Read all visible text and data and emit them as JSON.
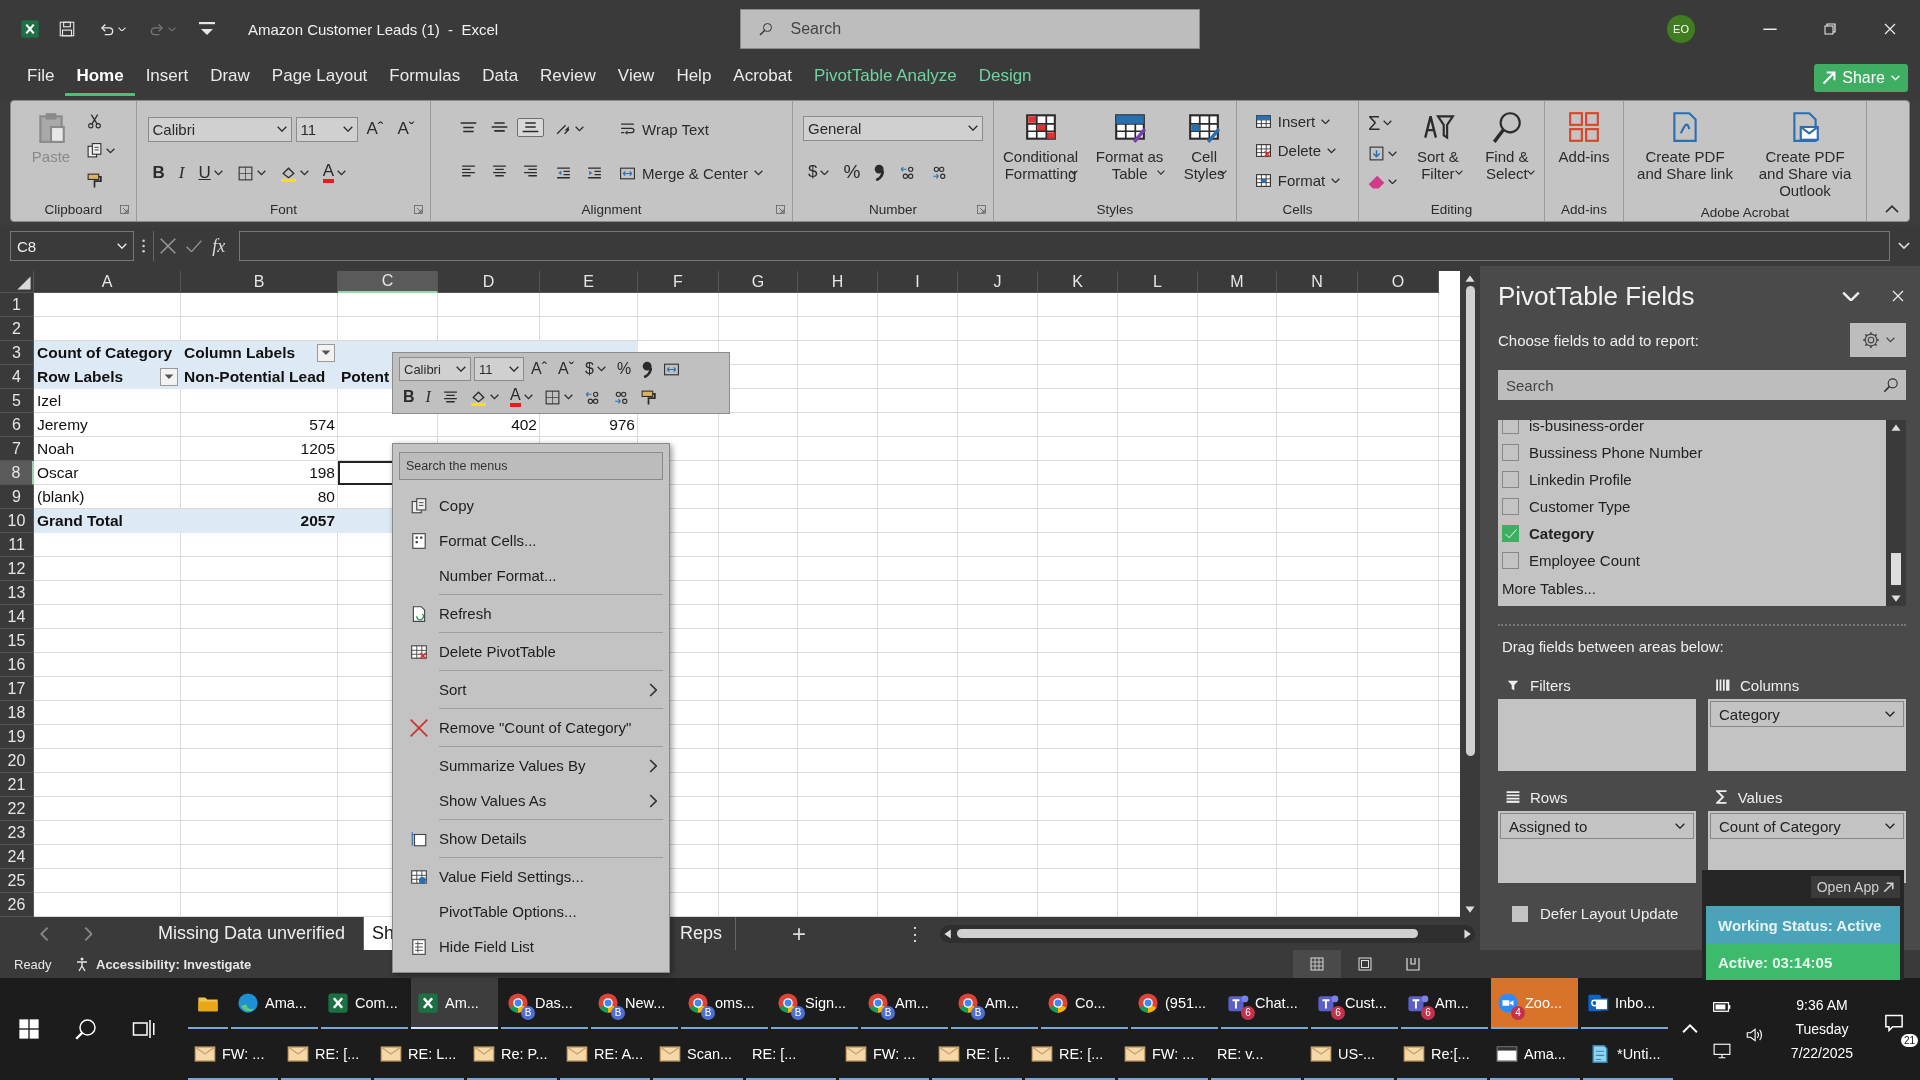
{
  "title_bar": {
    "quick_access": [
      {
        "kind": "save",
        "disabled": false
      },
      {
        "kind": "undo",
        "disabled": false
      },
      {
        "kind": "redo",
        "disabled": true
      },
      {
        "kind": "customize",
        "disabled": false
      }
    ],
    "document_title": "Amazon Customer Leads (1)  -  Excel",
    "search": {
      "placeholder": "Search"
    },
    "account": {
      "initials": "EO"
    }
  },
  "ribbon_tabs": [
    {
      "label": "File",
      "kind": "standard",
      "selected": false
    },
    {
      "label": "Home",
      "kind": "standard",
      "selected": true
    },
    {
      "label": "Insert",
      "kind": "standard",
      "selected": false
    },
    {
      "label": "Draw",
      "kind": "standard",
      "selected": false
    },
    {
      "label": "Page Layout",
      "kind": "standard",
      "selected": false
    },
    {
      "label": "Formulas",
      "kind": "standard",
      "selected": false
    },
    {
      "label": "Data",
      "kind": "standard",
      "selected": false
    },
    {
      "label": "Review",
      "kind": "standard",
      "selected": false
    },
    {
      "label": "View",
      "kind": "standard",
      "selected": false
    },
    {
      "label": "Help",
      "kind": "standard",
      "selected": false
    },
    {
      "label": "Acrobat",
      "kind": "standard",
      "selected": false
    },
    {
      "label": "PivotTable Analyze",
      "kind": "contextual",
      "selected": false
    },
    {
      "label": "Design",
      "kind": "contextual",
      "selected": false
    }
  ],
  "share_button": {
    "label": "Share"
  },
  "ribbon_groups": [
    {
      "label": "Clipboard",
      "launcher": true,
      "stacks": [
        {
          "kind": "large",
          "controls": [
            {
              "kind": "paste",
              "label": "Paste",
              "disabled": true
            }
          ]
        },
        {
          "kind": "stack",
          "rows": [
            {
              "controls": [
                {
                  "kind": "cut"
                }
              ]
            },
            {
              "controls": [
                {
                  "kind": "copy",
                  "menu": true
                }
              ]
            },
            {
              "controls": [
                {
                  "kind": "painter"
                }
              ]
            }
          ]
        }
      ]
    },
    {
      "label": "Font",
      "launcher": true,
      "stacks": [
        {
          "kind": "stack",
          "rows": [
            {
              "controls": [
                {
                  "kind": "font",
                  "value": "Calibri"
                },
                {
                  "kind": "size",
                  "value": "11"
                },
                {
                  "kind": "grow",
                  "label": "Aˆ"
                },
                {
                  "kind": "shrink",
                  "label": "Aˇ"
                }
              ]
            },
            {
              "controls": [
                {
                  "kind": "bold",
                  "label": "B"
                },
                {
                  "kind": "italic",
                  "label": "I"
                },
                {
                  "kind": "underline",
                  "label": "U",
                  "menu": true
                },
                {
                  "kind": "borders",
                  "menu": true
                },
                {
                  "kind": "fill",
                  "menu": true
                },
                {
                  "kind": "fontcolor",
                  "label": "A",
                  "menu": true
                }
              ]
            }
          ]
        }
      ]
    },
    {
      "label": "Alignment",
      "launcher": true,
      "stacks": [
        {
          "kind": "stack",
          "rows": [
            {
              "controls": [
                {
                  "kind": "aligntop",
                  "pressed": false
                },
                {
                  "kind": "alignmiddle",
                  "pressed": false
                },
                {
                  "kind": "alignbottom",
                  "pressed": true
                }
              ]
            },
            {
              "controls": [
                {
                  "kind": "alignleft",
                  "pressed": false
                },
                {
                  "kind": "aligncenter",
                  "pressed": false
                },
                {
                  "kind": "alignright",
                  "pressed": false
                }
              ]
            }
          ]
        },
        {
          "kind": "stack",
          "rows": [
            {
              "controls": [
                {
                  "kind": "orientation",
                  "menu": true
                }
              ]
            },
            {
              "controls": [
                {
                  "kind": "indentdec"
                },
                {
                  "kind": "indentinc"
                }
              ]
            }
          ]
        },
        {
          "kind": "stack",
          "rows": [
            {
              "controls": [
                {
                  "kind": "wrap",
                  "label": "Wrap Text"
                }
              ]
            },
            {
              "controls": [
                {
                  "kind": "merge",
                  "label": "Merge & Center",
                  "menu": true
                }
              ]
            }
          ]
        }
      ]
    },
    {
      "label": "Number",
      "launcher": true,
      "stacks": [
        {
          "kind": "stack",
          "rows": [
            {
              "controls": [
                {
                  "kind": "format",
                  "value": "General"
                }
              ]
            },
            {
              "controls": [
                {
                  "kind": "currency",
                  "label": "$",
                  "menu": true
                },
                {
                  "kind": "percent",
                  "label": "%"
                },
                {
                  "kind": "comma"
                },
                {
                  "kind": "incdec"
                },
                {
                  "kind": "decdec"
                }
              ]
            }
          ]
        }
      ]
    },
    {
      "label": "Styles",
      "launcher": false,
      "stacks": [
        {
          "kind": "large",
          "controls": [
            {
              "kind": "condfmt",
              "label": "Conditional Formatting",
              "menu": true
            }
          ]
        },
        {
          "kind": "large",
          "controls": [
            {
              "kind": "fmttable",
              "label": "Format as Table",
              "menu": true
            }
          ]
        },
        {
          "kind": "large",
          "controls": [
            {
              "kind": "cellstyles",
              "label": "Cell Styles",
              "menu": true
            }
          ]
        }
      ]
    },
    {
      "label": "Cells",
      "launcher": false,
      "stacks": [
        {
          "kind": "stack",
          "rows": [
            {
              "controls": [
                {
                  "kind": "insert",
                  "label": "Insert",
                  "menu": true
                }
              ]
            },
            {
              "controls": [
                {
                  "kind": "delete",
                  "label": "Delete",
                  "menu": true
                }
              ]
            },
            {
              "controls": [
                {
                  "kind": "format",
                  "label": "Format",
                  "menu": true
                }
              ]
            }
          ]
        }
      ]
    },
    {
      "label": "Editing",
      "launcher": false,
      "stacks": [
        {
          "kind": "stack",
          "rows": [
            {
              "controls": [
                {
                  "kind": "sigma",
                  "label": "Σ",
                  "menu": true
                }
              ]
            },
            {
              "controls": [
                {
                  "kind": "filldown",
                  "menu": true
                }
              ]
            },
            {
              "controls": [
                {
                  "kind": "eraser",
                  "menu": true
                }
              ]
            }
          ]
        },
        {
          "kind": "large",
          "controls": [
            {
              "kind": "sortfilter",
              "label": "Sort & Filter",
              "menu": true
            }
          ]
        },
        {
          "kind": "large",
          "controls": [
            {
              "kind": "find",
              "label": "Find & Select",
              "menu": true
            }
          ]
        }
      ]
    },
    {
      "label": "Add-ins",
      "launcher": false,
      "stacks": [
        {
          "kind": "large",
          "controls": [
            {
              "kind": "addins",
              "label": "Add-ins"
            }
          ]
        }
      ]
    },
    {
      "label": "Adobe Acrobat",
      "launcher": false,
      "stacks": [
        {
          "kind": "large",
          "controls": [
            {
              "kind": "pdf",
              "label": "Create PDF and Share link"
            }
          ]
        },
        {
          "kind": "large",
          "controls": [
            {
              "kind": "pdfoutlook",
              "label": "Create PDF and Share via Outlook"
            }
          ]
        }
      ]
    }
  ],
  "formula_bar": {
    "name_box": "C8",
    "insert_function": "fx"
  },
  "sheet": {
    "columns": [
      {
        "label": "A",
        "selected": false
      },
      {
        "label": "B",
        "selected": false
      },
      {
        "label": "C",
        "selected": true
      },
      {
        "label": "D",
        "selected": false
      },
      {
        "label": "E",
        "selected": false
      },
      {
        "label": "F",
        "selected": false
      },
      {
        "label": "G",
        "selected": false
      },
      {
        "label": "H",
        "selected": false
      },
      {
        "label": "I",
        "selected": false
      },
      {
        "label": "J",
        "selected": false
      },
      {
        "label": "K",
        "selected": false
      },
      {
        "label": "L",
        "selected": false
      },
      {
        "label": "M",
        "selected": false
      },
      {
        "label": "N",
        "selected": false
      },
      {
        "label": "O",
        "selected": false
      }
    ],
    "rows": [
      {
        "label": "1",
        "selected": false
      },
      {
        "label": "2",
        "selected": false
      },
      {
        "label": "3",
        "selected": false,
        "cells": [
          {
            "kind": "text",
            "text": "Count of Category",
            "bold": true,
            "band": true,
            "filter": false,
            "selected": false
          },
          {
            "kind": "text",
            "text": "Column Labels",
            "bold": true,
            "band": true,
            "filter": true,
            "selected": false
          },
          {
            "kind": "empty",
            "band": true,
            "selected": false
          },
          {
            "kind": "empty",
            "band": true,
            "selected": false
          },
          {
            "kind": "empty",
            "band": true,
            "selected": false
          }
        ]
      },
      {
        "label": "4",
        "selected": false,
        "cells": [
          {
            "kind": "text",
            "text": "Row Labels",
            "bold": true,
            "band": true,
            "filter": true,
            "selected": false
          },
          {
            "kind": "text",
            "text": "Non-Potential Lead",
            "bold": true,
            "band": true,
            "filter": false,
            "selected": false
          },
          {
            "kind": "text",
            "text": "Potent",
            "bold": true,
            "band": true,
            "filter": false,
            "selected": false
          }
        ]
      },
      {
        "label": "5",
        "selected": false,
        "cells": [
          {
            "kind": "text",
            "text": "Izel",
            "bold": false,
            "band": false,
            "filter": false,
            "selected": false
          }
        ]
      },
      {
        "label": "6",
        "selected": false,
        "cells": [
          {
            "kind": "text",
            "text": "Jeremy",
            "bold": false,
            "band": false,
            "filter": false,
            "selected": false
          },
          {
            "kind": "number",
            "text": "574",
            "bold": false,
            "band": false,
            "filter": false,
            "selected": false
          },
          {
            "kind": "empty",
            "band": false,
            "selected": false
          },
          {
            "kind": "number",
            "text": "402",
            "bold": false,
            "band": false,
            "filter": false,
            "selected": false
          },
          {
            "kind": "number",
            "text": "976",
            "bold": false,
            "band": false,
            "filter": false,
            "selected": false
          }
        ]
      },
      {
        "label": "7",
        "selected": false,
        "cells": [
          {
            "kind": "text",
            "text": "Noah",
            "bold": false,
            "band": false,
            "filter": false,
            "selected": false
          },
          {
            "kind": "number",
            "text": "1205",
            "bold": false,
            "band": false,
            "filter": false,
            "selected": false
          }
        ]
      },
      {
        "label": "8",
        "selected": true,
        "cells": [
          {
            "kind": "text",
            "text": "Oscar",
            "bold": false,
            "band": false,
            "filter": false,
            "selected": false
          },
          {
            "kind": "number",
            "text": "198",
            "bold": false,
            "band": false,
            "filter": false,
            "selected": false
          },
          {
            "kind": "empty",
            "band": false,
            "selected": true
          }
        ]
      },
      {
        "label": "9",
        "selected": false,
        "cells": [
          {
            "kind": "text",
            "text": "(blank)",
            "bold": false,
            "band": false,
            "filter": false,
            "selected": false
          },
          {
            "kind": "number",
            "text": "80",
            "bold": false,
            "band": false,
            "filter": false,
            "selected": false
          }
        ]
      },
      {
        "label": "10",
        "selected": false,
        "cells": [
          {
            "kind": "text",
            "text": "Grand Total",
            "bold": true,
            "band": true,
            "filter": false,
            "selected": false
          },
          {
            "kind": "number",
            "text": "2057",
            "bold": true,
            "band": true,
            "filter": false,
            "selected": false
          },
          {
            "kind": "empty",
            "band": true,
            "selected": false
          }
        ]
      },
      {
        "label": "11",
        "selected": false
      },
      {
        "label": "12",
        "selected": false
      },
      {
        "label": "13",
        "selected": false
      },
      {
        "label": "14",
        "selected": false
      },
      {
        "label": "15",
        "selected": false
      },
      {
        "label": "16",
        "selected": false
      },
      {
        "label": "17",
        "selected": false
      },
      {
        "label": "18",
        "selected": false
      },
      {
        "label": "19",
        "selected": false
      },
      {
        "label": "20",
        "selected": false
      },
      {
        "label": "21",
        "selected": false
      },
      {
        "label": "22",
        "selected": false
      },
      {
        "label": "23",
        "selected": false
      },
      {
        "label": "24",
        "selected": false
      },
      {
        "label": "25",
        "selected": false
      },
      {
        "label": "26",
        "selected": false
      }
    ]
  },
  "sheet_tabs": {
    "tabs": [
      {
        "label": "Missing Data unverified",
        "selected": false
      },
      {
        "label": "Sh",
        "selected": true
      },
      {
        "label": "Reps",
        "selected": false
      }
    ],
    "add": "+",
    "more": "⋮"
  },
  "mini_toolbar": {
    "rows": [
      {
        "controls": [
          {
            "kind": "font",
            "value": "Calibri"
          },
          {
            "kind": "size",
            "value": "11"
          },
          {
            "kind": "grow",
            "label": "Aˆ"
          },
          {
            "kind": "shrink",
            "label": "Aˇ"
          },
          {
            "kind": "currency",
            "label": "$",
            "menu": true
          },
          {
            "kind": "percent",
            "label": "%"
          },
          {
            "kind": "comma"
          },
          {
            "kind": "merge"
          }
        ]
      },
      {
        "controls": [
          {
            "kind": "bold",
            "label": "B"
          },
          {
            "kind": "italic",
            "label": "I"
          },
          {
            "kind": "aligncenter"
          },
          {
            "kind": "fill",
            "menu": true
          },
          {
            "kind": "fontcolor",
            "label": "A",
            "menu": true
          },
          {
            "kind": "borders",
            "menu": true
          },
          {
            "kind": "incdec"
          },
          {
            "kind": "decdec"
          },
          {
            "kind": "painter"
          }
        ]
      }
    ]
  },
  "context_menu": {
    "search": {
      "placeholder": "Search the menus"
    },
    "items": [
      {
        "label": "Copy",
        "kind": "copy",
        "submenu": false,
        "separator_before": false
      },
      {
        "label": "Format Cells...",
        "kind": "formatcells",
        "submenu": false,
        "separator_before": false
      },
      {
        "label": "Number Format...",
        "kind": "none",
        "submenu": false,
        "separator_before": false
      },
      {
        "label": "Refresh",
        "kind": "refresh",
        "submenu": false,
        "separator_before": true
      },
      {
        "label": "Delete PivotTable",
        "kind": "deletepivot",
        "submenu": false,
        "separator_before": true
      },
      {
        "label": "Sort",
        "kind": "none",
        "submenu": true,
        "separator_before": true
      },
      {
        "label": "Remove \"Count of Category\"",
        "kind": "remove",
        "submenu": false,
        "separator_before": true
      },
      {
        "label": "Summarize Values By",
        "kind": "none",
        "submenu": true,
        "separator_before": true
      },
      {
        "label": "Show Values As",
        "kind": "none",
        "submenu": true,
        "separator_before": false
      },
      {
        "label": "Show Details",
        "kind": "showdetails",
        "submenu": false,
        "separator_before": true
      },
      {
        "label": "Value Field Settings...",
        "kind": "valuesettings",
        "submenu": false,
        "separator_before": true
      },
      {
        "label": "PivotTable Options...",
        "kind": "none",
        "submenu": false,
        "separator_before": false
      },
      {
        "label": "Hide Field List",
        "kind": "hidefields",
        "submenu": false,
        "separator_before": false
      }
    ]
  },
  "pivot_pane": {
    "title": "PivotTable Fields",
    "subtitle": "Choose fields to add to report:",
    "search": {
      "placeholder": "Search"
    },
    "fields": [
      {
        "label": "is-business-order",
        "checked": false
      },
      {
        "label": "Bussiness Phone Number",
        "checked": false
      },
      {
        "label": "Linkedin Profile",
        "checked": false
      },
      {
        "label": "Customer Type",
        "checked": false
      },
      {
        "label": "Category",
        "checked": true
      },
      {
        "label": "Employee Count",
        "checked": false
      }
    ],
    "more_tables": "More Tables...",
    "areas_hint": "Drag fields between areas below:",
    "areas": [
      {
        "label": "Filters",
        "kind": "filters"
      },
      {
        "label": "Columns",
        "kind": "columns",
        "fields": [
          "Category"
        ]
      },
      {
        "label": "Rows",
        "kind": "rows",
        "fields": [
          "Assigned to"
        ]
      },
      {
        "label": "Values",
        "kind": "values",
        "fields": [
          "Count of Category"
        ]
      }
    ],
    "defer_update": {
      "label": "Defer Layout Update",
      "checked": false
    }
  },
  "timer_widget": {
    "open_button": "Open App",
    "status": "Working Status: Active",
    "timer": "Active: 03:14:05"
  },
  "status_bar": {
    "ready": "Ready",
    "accessibility": "Accessibility: Investigate",
    "views": [
      {
        "kind": "normal",
        "selected": true
      },
      {
        "kind": "pagelayout",
        "selected": false
      },
      {
        "kind": "pagebreak",
        "selected": false
      }
    ]
  },
  "taskbar": {
    "rows": [
      {
        "items": [
          {
            "kind": "explorer",
            "selected": false,
            "attention": false
          },
          {
            "label": "Ama...",
            "kind": "edge",
            "selected": false,
            "attention": false
          },
          {
            "label": "Com...",
            "kind": "excel",
            "selected": false,
            "attention": false
          },
          {
            "label": "Am...",
            "kind": "excel",
            "selected": true,
            "attention": false
          },
          {
            "label": "Das...",
            "kind": "chrome",
            "badge": "B",
            "selected": false,
            "attention": false
          },
          {
            "label": "New...",
            "kind": "chrome",
            "badge": "B",
            "selected": false,
            "attention": false
          },
          {
            "label": "oms...",
            "kind": "chrome",
            "badge": "B",
            "selected": false,
            "attention": false
          },
          {
            "label": "Sign...",
            "kind": "chrome",
            "badge": "B",
            "selected": false,
            "attention": false
          },
          {
            "label": "Am...",
            "kind": "chrome",
            "badge": "B",
            "selected": false,
            "attention": false
          },
          {
            "label": "Am...",
            "kind": "chrome",
            "badge": "B",
            "selected": false,
            "attention": false
          },
          {
            "label": "Co...",
            "kind": "chrome",
            "selected": false,
            "attention": false
          },
          {
            "label": "(951...",
            "kind": "chrome",
            "selected": false,
            "attention": false
          },
          {
            "label": "Chat...",
            "kind": "teams",
            "badge": "6",
            "selected": false,
            "attention": false
          },
          {
            "label": "Cust...",
            "kind": "teams",
            "badge": "6",
            "selected": false,
            "attention": false
          },
          {
            "label": "Am...",
            "kind": "teams",
            "badge": "6",
            "selected": false,
            "attention": false
          },
          {
            "label": "Zoo...",
            "kind": "zoom",
            "badge": "4",
            "selected": false,
            "attention": true
          },
          {
            "label": "Inbo...",
            "kind": "outlook",
            "selected": false,
            "attention": false
          }
        ]
      },
      {
        "items": [
          {
            "label": "FW: ...",
            "kind": "mail",
            "selected": false,
            "attention": false
          },
          {
            "label": "RE: [...",
            "kind": "mail",
            "selected": false,
            "attention": false
          },
          {
            "label": "RE: L...",
            "kind": "mail",
            "selected": false,
            "attention": false
          },
          {
            "label": "Re: P...",
            "kind": "mail",
            "selected": false,
            "attention": false
          },
          {
            "label": "RE: A...",
            "kind": "mail",
            "selected": false,
            "attention": false
          },
          {
            "label": "Scan...",
            "kind": "mail",
            "selected": false,
            "attention": false
          },
          {
            "label": "RE: [...",
            "kind": "none",
            "selected": false,
            "attention": false
          },
          {
            "label": "FW: ...",
            "kind": "mail",
            "selected": false,
            "attention": false
          },
          {
            "label": "RE: [...",
            "kind": "mail",
            "selected": false,
            "attention": false
          },
          {
            "label": "RE: [...",
            "kind": "mail",
            "selected": false,
            "attention": false
          },
          {
            "label": "FW: ...",
            "kind": "mail",
            "selected": false,
            "attention": false
          },
          {
            "label": "RE: v...",
            "kind": "none",
            "selected": false,
            "attention": false
          },
          {
            "label": "US-...",
            "kind": "mail",
            "selected": false,
            "attention": false
          },
          {
            "label": "Re:[...",
            "kind": "mail",
            "selected": false,
            "attention": false
          },
          {
            "label": "Ama...",
            "kind": "window",
            "selected": false,
            "attention": false
          },
          {
            "label": "*Unti...",
            "kind": "notepad",
            "selected": false,
            "attention": false
          }
        ]
      }
    ],
    "clock": {
      "time": "9:36 AM",
      "day": "Tuesday",
      "date": "7/22/2025"
    },
    "notifications": "21"
  }
}
